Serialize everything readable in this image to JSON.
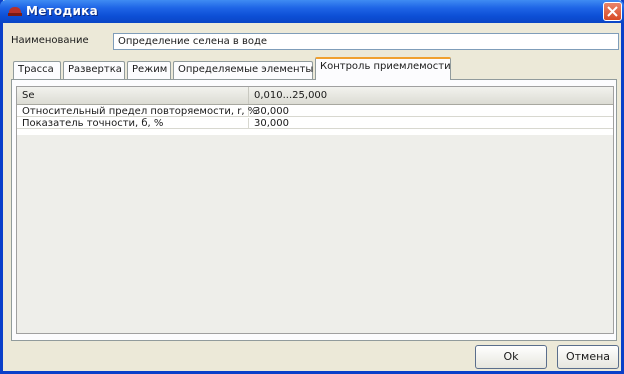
{
  "window": {
    "title": "Методика",
    "colors": {
      "titlebar": "#0d4fd6",
      "close": "#d84a25",
      "face": "#ece9d8",
      "active_tab_accent": "#f0a030"
    }
  },
  "name_row": {
    "label": "Наименование",
    "value": "Определение селена в воде"
  },
  "tabs": [
    {
      "label": "Трасса",
      "active": false
    },
    {
      "label": "Развертка",
      "active": false
    },
    {
      "label": "Режим",
      "active": false
    },
    {
      "label": "Определяемые элементы",
      "active": false
    },
    {
      "label": "Контроль приемлемости",
      "active": true
    }
  ],
  "grid": {
    "header": {
      "element": "Se",
      "range": "0,010...25,000"
    },
    "rows": [
      {
        "name": "Относительный предел повторяемости, r, %",
        "value": "30,000"
      },
      {
        "name": "Показатель точности, б, %",
        "value": "30,000"
      }
    ]
  },
  "buttons": {
    "ok": "Ok",
    "cancel": "Отмена"
  }
}
